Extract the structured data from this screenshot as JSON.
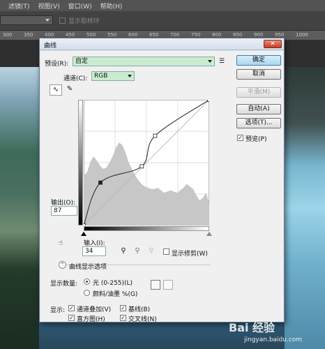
{
  "app": {
    "menu": [
      "滤镜(T)",
      "视图(V)",
      "窗口(W)",
      "帮助(H)"
    ],
    "options_bar": {
      "checkbox_label": "显示取样环"
    },
    "ruler_ticks": [
      "300",
      "350",
      "400",
      "450",
      "500",
      "550",
      "600",
      "650",
      "700",
      "750",
      "800",
      "850",
      "900",
      "950",
      "1000"
    ]
  },
  "dialog": {
    "title": "曲线",
    "close_glyph": "✕",
    "preset": {
      "label": "预设(R):",
      "value": "自定"
    },
    "channel": {
      "label": "通道(C):",
      "value": "RGB"
    },
    "output": {
      "label": "输出(O):",
      "value": "87"
    },
    "input": {
      "label": "输入(I):",
      "value": "34"
    },
    "show_clipping": {
      "label": "显示修剪(W)",
      "checked": false
    },
    "buttons": {
      "ok": "确定",
      "cancel": "取消",
      "smooth": "平滑(M)",
      "auto": "自动(A)",
      "options": "选项(T)..."
    },
    "preview": {
      "label": "预览(P)",
      "checked": true
    },
    "curve_options": {
      "header": "曲线显示选项",
      "show_amount_label": "显示数量:",
      "light": "光 (0-255)(L)",
      "pigment": "颜料/油墨 %(G)",
      "show_label": "显示:",
      "channel_overlays": "通道叠加(V)",
      "baseline": "基线(B)",
      "histogram": "直方图(H)",
      "intersection": "交叉线(N)"
    },
    "checkmark": "✓"
  },
  "chart_data": {
    "type": "line",
    "curve_points": [
      [
        0,
        0
      ],
      [
        34,
        87
      ],
      [
        118,
        120
      ],
      [
        145,
        182
      ],
      [
        255,
        255
      ]
    ],
    "xlim": [
      0,
      255
    ],
    "ylim": [
      0,
      255
    ],
    "grid": true
  },
  "watermark": {
    "text": "Bai 经验",
    "url": "jingyan.baidu.com"
  }
}
